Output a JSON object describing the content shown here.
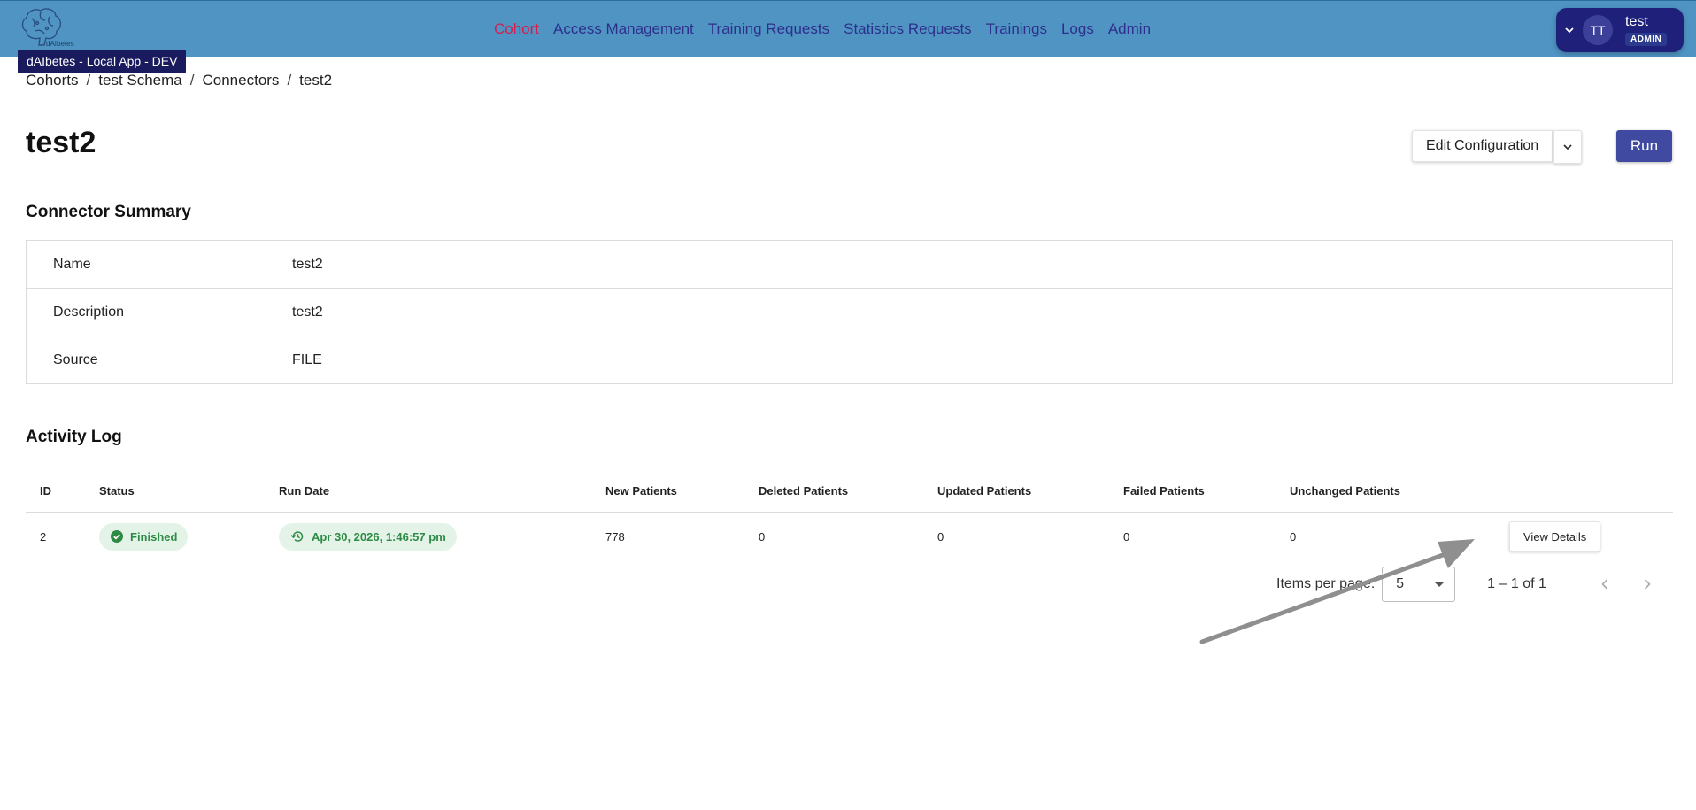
{
  "app": {
    "logo_text": "dAIbetes",
    "env_badge": "dAIbetes - Local App - DEV"
  },
  "nav": {
    "items": [
      {
        "label": "Cohort",
        "active": true
      },
      {
        "label": "Access Management"
      },
      {
        "label": "Training Requests"
      },
      {
        "label": "Statistics Requests"
      },
      {
        "label": "Trainings"
      },
      {
        "label": "Logs"
      },
      {
        "label": "Admin"
      }
    ]
  },
  "user": {
    "initials": "TT",
    "name": "test",
    "role": "ADMIN"
  },
  "breadcrumb": [
    "Cohorts",
    "test Schema",
    "Connectors",
    "test2"
  ],
  "page": {
    "title": "test2",
    "edit_label": "Edit Configuration",
    "run_label": "Run"
  },
  "summary": {
    "title": "Connector Summary",
    "rows": [
      {
        "label": "Name",
        "value": "test2"
      },
      {
        "label": "Description",
        "value": "test2"
      },
      {
        "label": "Source",
        "value": "FILE"
      }
    ]
  },
  "activity": {
    "title": "Activity Log",
    "columns": [
      "ID",
      "Status",
      "Run Date",
      "New Patients",
      "Deleted Patients",
      "Updated Patients",
      "Failed Patients",
      "Unchanged Patients"
    ],
    "rows": [
      {
        "id": "2",
        "status": "Finished",
        "run_date": "Apr 30, 2026, 1:46:57 pm",
        "new": "778",
        "deleted": "0",
        "updated": "0",
        "failed": "0",
        "unchanged": "0",
        "action": "View Details"
      }
    ]
  },
  "paginator": {
    "label": "Items per page:",
    "page_size": "5",
    "range": "1 – 1 of 1"
  },
  "colors": {
    "topbar": "#4f94c3",
    "nav_text": "#2e2f8c",
    "nav_active": "#d02050",
    "primary": "#3f4aa0",
    "success_bg": "#e4f3e8",
    "success_text": "#2e8b45"
  }
}
